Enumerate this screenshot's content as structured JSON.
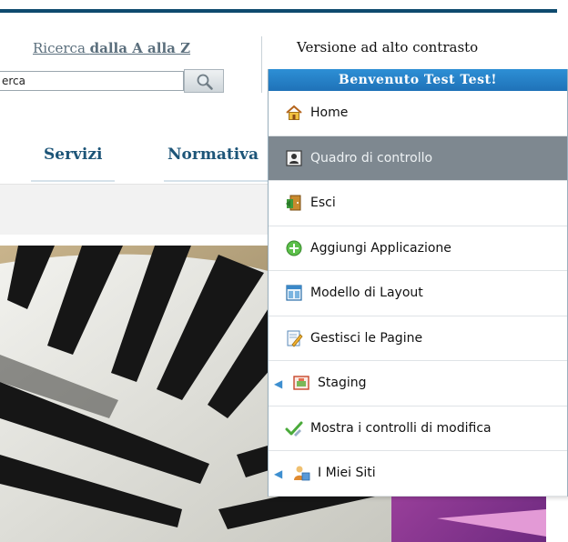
{
  "header": {
    "az_link_prefix": "Ricerca ",
    "az_link_bold": "dalla A alla Z",
    "search_value": "erca",
    "contrast_link": "Versione ad alto contrasto"
  },
  "nav": {
    "tabs": [
      {
        "label": "Servizi"
      },
      {
        "label": "Normativa"
      }
    ]
  },
  "dock": {
    "welcome": "Benvenuto Test Test!",
    "items": [
      {
        "label": "Home",
        "icon": "home-icon"
      },
      {
        "label": "Quadro di controllo",
        "icon": "control-panel-icon",
        "active": true
      },
      {
        "label": "Esci",
        "icon": "exit-door-icon"
      },
      {
        "label": "Aggiungi Applicazione",
        "icon": "add-circle-icon"
      },
      {
        "label": "Modello di Layout",
        "icon": "layout-template-icon"
      },
      {
        "label": "Gestisci le Pagine",
        "icon": "manage-pages-icon"
      },
      {
        "label": "Staging",
        "icon": "staging-icon",
        "submenu": true
      },
      {
        "label": "Mostra i controlli di modifica",
        "icon": "checkmark-icon"
      },
      {
        "label": "I Miei Siti",
        "icon": "my-sites-icon",
        "submenu": true
      }
    ]
  },
  "colors": {
    "brand_rule": "#0e4a6e",
    "nav_text": "#1d5578",
    "dock_header": "#1f72b8",
    "active_item": "#7e8890"
  }
}
